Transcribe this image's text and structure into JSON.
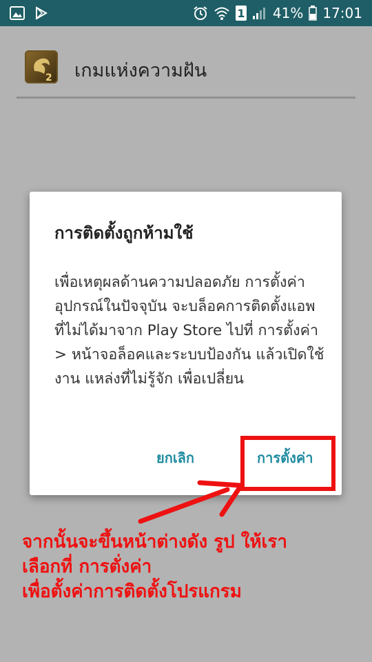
{
  "status_bar": {
    "battery_percent": "41%",
    "time": "17:01",
    "sim_label": "1",
    "left_icons": [
      "gallery-icon",
      "play-store-icon"
    ],
    "right_icons": [
      "alarm-icon",
      "wifi-icon",
      "sim-icon",
      "signal-icon",
      "battery-icon"
    ]
  },
  "app_header": {
    "title": "เกมแห่งความฝัน",
    "icon": "app-logo-icon"
  },
  "dialog": {
    "title": "การติดตั้งถูกห้ามใช้",
    "message": "เพื่อเหตุผลด้านความปลอดภัย การตั้งค่าอุปกรณ์ในปัจจุบัน จะบล็อคการติดตั้งแอพที่ไม่ได้มาจาก Play Store ไปที่ การตั้งค่า > หน้าจอล็อคและระบบป้องกัน แล้วเปิดใช้งาน แหล่งที่ไม่รู้จัก เพื่อเปลี่ยน",
    "cancel_label": "ยกเลิก",
    "settings_label": "การตั้งค่า"
  },
  "annotation": {
    "line1": "จากนั้นจะขึ้นหน้าต่างดัง รูป ให้เรา",
    "line2": "เลือกที่ การตั่งค่า",
    "line3": "เพื่อตั้งค่าการติดตั้งโปรแกรม",
    "color": "#ee1111"
  },
  "colors": {
    "status_bar": "#1f5e66",
    "dim_background": "#b3b3b3",
    "accent_button": "#1f8ba0"
  }
}
